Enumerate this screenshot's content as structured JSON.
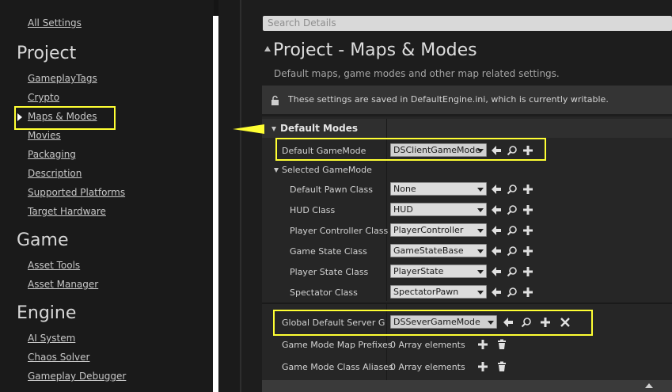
{
  "sidebar": {
    "all_settings": "All Settings",
    "project": {
      "title": "Project",
      "items": [
        "GameplayTags",
        "Crypto",
        "Maps & Modes",
        "Movies",
        "Packaging",
        "Description",
        "Supported Platforms",
        "Target Hardware"
      ],
      "selected": "Maps & Modes"
    },
    "game": {
      "title": "Game",
      "items": [
        "Asset Tools",
        "Asset Manager"
      ]
    },
    "engine": {
      "title": "Engine",
      "items": [
        "AI System",
        "Chaos Solver",
        "Gameplay Debugger"
      ]
    }
  },
  "details": {
    "search_placeholder": "Search Details",
    "title": "Project - Maps & Modes",
    "subtitle": "Default maps, game modes and other map related settings.",
    "notice": "These settings are saved in DefaultEngine.ini, which is currently writable."
  },
  "default_modes": {
    "header": "Default Modes",
    "default_gamemode": {
      "label": "Default GameMode",
      "value": "DSClientGameMode"
    },
    "selected_gamemode": {
      "label": "Selected GameMode",
      "rows": [
        {
          "label": "Default Pawn Class",
          "value": "None"
        },
        {
          "label": "HUD Class",
          "value": "HUD"
        },
        {
          "label": "Player Controller Class",
          "value": "PlayerController"
        },
        {
          "label": "Game State Class",
          "value": "GameStateBase"
        },
        {
          "label": "Player State Class",
          "value": "PlayerState"
        },
        {
          "label": "Spectator Class",
          "value": "SpectatorPawn"
        }
      ]
    },
    "global_server": {
      "label": "Global Default Server Gam",
      "value": "DSSeverGameMode"
    },
    "map_prefixes": {
      "label": "Game Mode Map Prefixes",
      "value": "0 Array elements"
    },
    "class_aliases": {
      "label": "Game Mode Class Aliases",
      "value": "0 Array elements"
    }
  },
  "colors": {
    "highlight": "#ffff33",
    "background": "#1d1d1d",
    "panel": "#262626"
  },
  "icons": [
    "lock-icon",
    "arrow-left-icon",
    "search-icon",
    "plus-icon",
    "close-icon",
    "trash-icon",
    "caret-down-icon",
    "scroll-up-icon"
  ]
}
